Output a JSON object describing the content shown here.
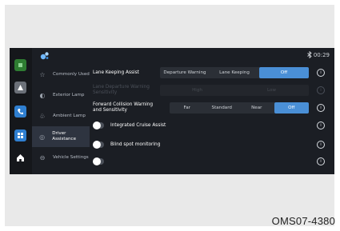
{
  "status": {
    "bluetooth_icon": "bluetooth-icon",
    "time": "00:29"
  },
  "dock": [
    {
      "name": "dock-green-app",
      "icon": "app-icon",
      "color": "#2e7d32"
    },
    {
      "name": "dock-nav-app",
      "icon": "navigation-icon",
      "color": "#6b7078"
    },
    {
      "name": "dock-phone-app",
      "icon": "phone-icon",
      "color": "#2f7fd0"
    },
    {
      "name": "dock-grid-app",
      "icon": "grid-icon",
      "color": "#2f7fd0"
    },
    {
      "name": "dock-home",
      "icon": "home-icon",
      "color": "#1b1e24"
    }
  ],
  "menu": {
    "items": [
      {
        "label": "Commonly Used",
        "icon": "star-icon"
      },
      {
        "label": "Exterior Lamp",
        "icon": "exterior-lamp-icon"
      },
      {
        "label": "Ambient Lamp",
        "icon": "ambient-lamp-icon"
      },
      {
        "label": "Driver Assistance",
        "icon": "driver-assistance-icon",
        "active": true
      },
      {
        "label": "Vehicle Settings",
        "icon": "vehicle-icon"
      }
    ]
  },
  "settings": {
    "lane_keeping": {
      "label": "Lane Keeping Assist",
      "options": [
        "Departure Warning",
        "Lane Keeping",
        "Off"
      ],
      "selected": "Off"
    },
    "lane_departure_sensitivity": {
      "label": "Lane Departure Warning Sensitivity",
      "options": [
        "High",
        "Low"
      ]
    },
    "forward_collision": {
      "label": "Forward Collision Warning and Sensitivity",
      "options": [
        "Far",
        "Standard",
        "Near",
        "Off"
      ],
      "selected": "Off"
    },
    "integrated_cruise": {
      "label": "Integrated Cruise Assist",
      "on": false
    },
    "blind_spot": {
      "label": "Blind spot monitoring",
      "on": false
    },
    "info_glyph": "i"
  },
  "accent_color": "#4a8fd6",
  "caption": "OMS07-4380"
}
